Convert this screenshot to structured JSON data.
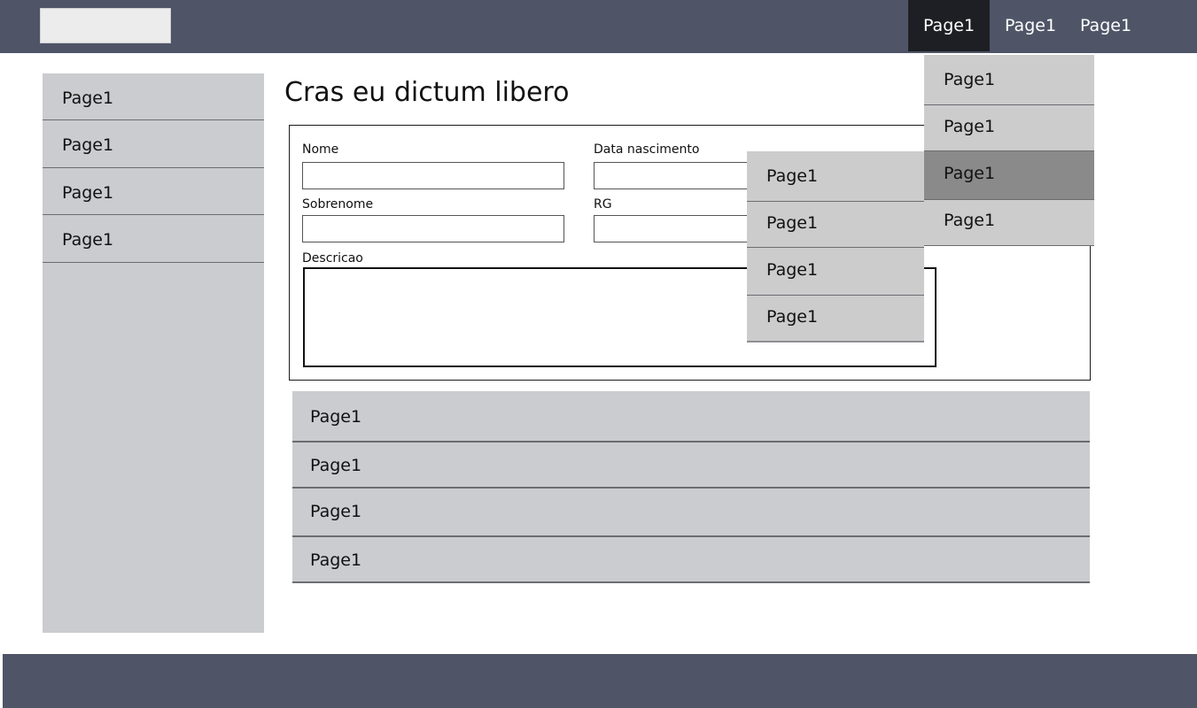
{
  "topnav": {
    "items": [
      {
        "label": "Page1"
      },
      {
        "label": "Page1"
      },
      {
        "label": "Page1"
      }
    ]
  },
  "sidebar": {
    "items": [
      {
        "label": "Page1"
      },
      {
        "label": "Page1"
      },
      {
        "label": "Page1"
      },
      {
        "label": "Page1"
      }
    ]
  },
  "main": {
    "title": "Cras eu dictum libero"
  },
  "form": {
    "nome_label": "Nome",
    "nome_value": "",
    "data_label": "Data nascimento",
    "data_value": "",
    "sobrenome_label": "Sobrenome",
    "sobrenome_value": "",
    "rg_label": "RG",
    "rg_value": "",
    "descricao_label": "Descricao",
    "descricao_value": ""
  },
  "list": {
    "items": [
      {
        "label": "Page1"
      },
      {
        "label": "Page1"
      },
      {
        "label": "Page1"
      },
      {
        "label": "Page1"
      }
    ]
  },
  "top_dropdown": {
    "items": [
      {
        "label": "Page1"
      },
      {
        "label": "Page1"
      },
      {
        "label": "Page1"
      },
      {
        "label": "Page1"
      }
    ]
  },
  "sub_dropdown": {
    "items": [
      {
        "label": "Page1"
      },
      {
        "label": "Page1"
      },
      {
        "label": "Page1"
      },
      {
        "label": "Page1"
      }
    ]
  },
  "colors": {
    "header": "#4f5567",
    "nav_active": "#1e1f24",
    "panel": "#cbccd0",
    "dropdown": "#cccccc",
    "dropdown_highlight": "#8a8a8a"
  }
}
